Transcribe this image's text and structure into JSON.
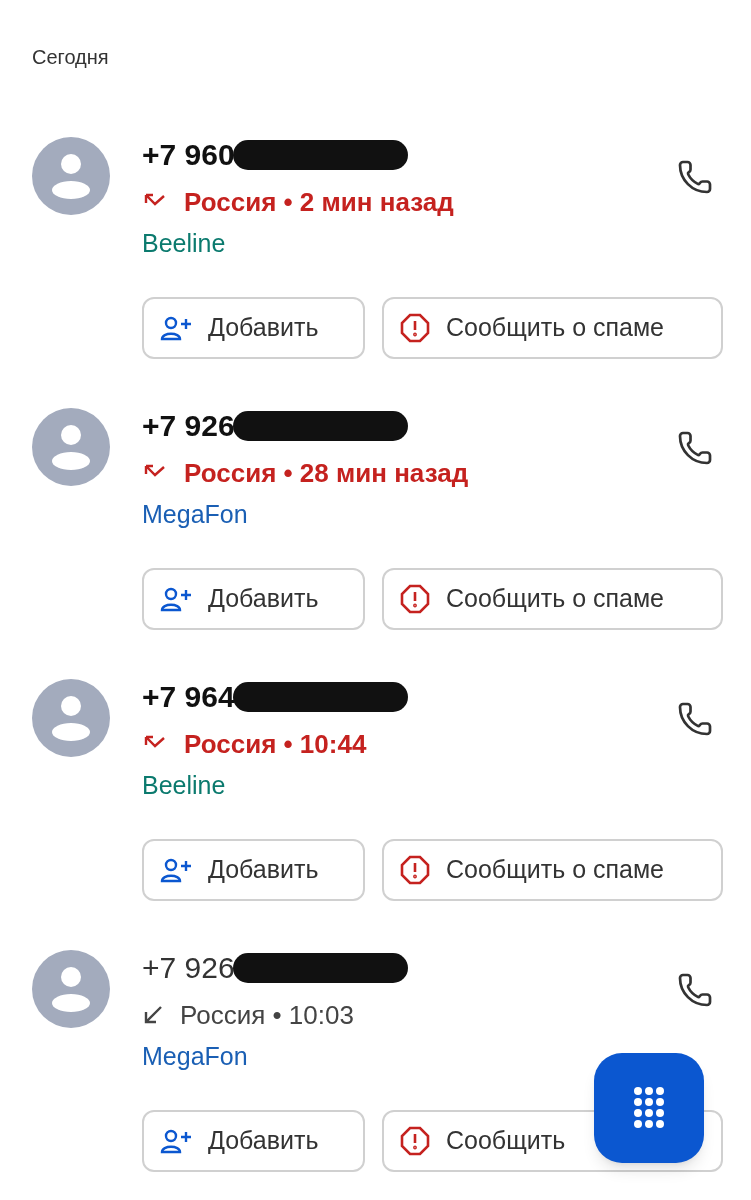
{
  "section_header": "Сегодня",
  "calls": [
    {
      "number": "+7 960",
      "redacted": true,
      "missed": true,
      "meta": "Россия • 2 мин назад",
      "carrier": "Beeline",
      "color": "#0b7a6e",
      "actions": [
        "Добавить",
        "Сообщить о спаме"
      ]
    },
    {
      "number": "+7 926",
      "redacted": true,
      "missed": true,
      "meta": "Россия • 28 мин назад",
      "carrier": "MegaFon",
      "color": "#1a5fb4",
      "actions": [
        "Добавить",
        "Сообщить о спаме"
      ]
    },
    {
      "number": "+7 964",
      "redacted": true,
      "missed": true,
      "meta": "Россия • 10:44",
      "carrier": "Beeline",
      "color": "#0b7a6e",
      "actions": [
        "Добавить",
        "Сообщить о спаме"
      ]
    },
    {
      "number": "+7 926",
      "redacted": true,
      "missed": false,
      "meta": "Россия • 10:03",
      "carrier": "MegaFon",
      "color": "#1a5fb4",
      "actions": [
        "Добавить",
        "Сообщить"
      ]
    }
  ],
  "dialpad_button": {
    "visible": true
  }
}
